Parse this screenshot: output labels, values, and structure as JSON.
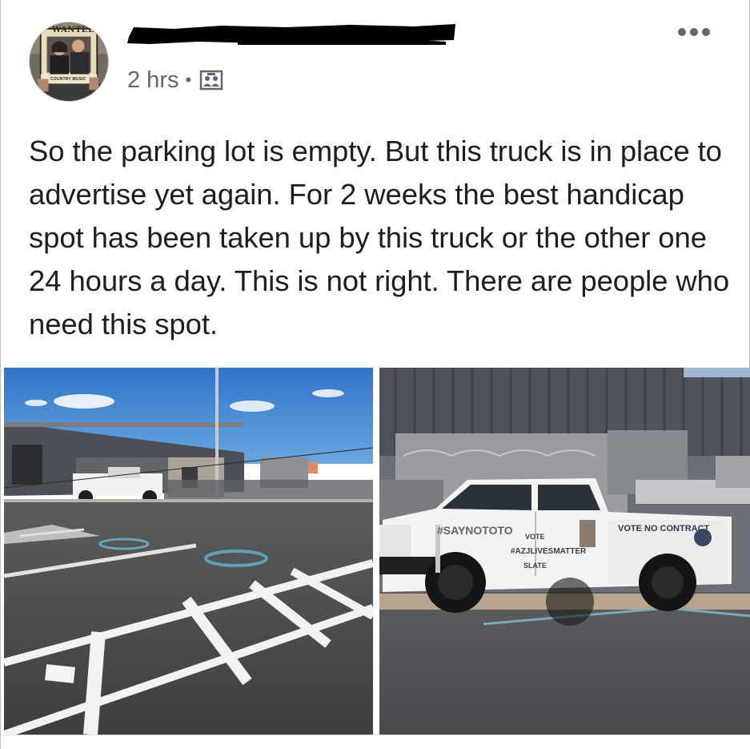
{
  "post": {
    "author_name_redacted": true,
    "timestamp": "2 hrs",
    "separator": "•",
    "audience_icon": "group-audience-icon",
    "more_icon": "more-options-icon",
    "text": "So the parking lot is empty. But this truck is in place to advertise yet again. For 2 weeks the best handicap spot has been taken up by this truck or the other one 24 hours a day. This is not right. There are people who need this spot."
  },
  "avatar": {
    "sign_text": "WANTED",
    "frame_caption": "COUNTRY MUSIC"
  },
  "photos": {
    "left": {
      "description_icon": "parking-lot-photo"
    },
    "right": {
      "truck_hashtag": "#SAYNOTOTO",
      "truck_vote": "VOTE",
      "truck_no_contract": "VOTE NO CONTRACT",
      "truck_slogan": "#AZJLIVESMATTER",
      "truck_slate": "SLATE"
    }
  },
  "colors": {
    "meta_gray": "#606770",
    "text": "#1c1e21",
    "redaction": "#000000"
  }
}
